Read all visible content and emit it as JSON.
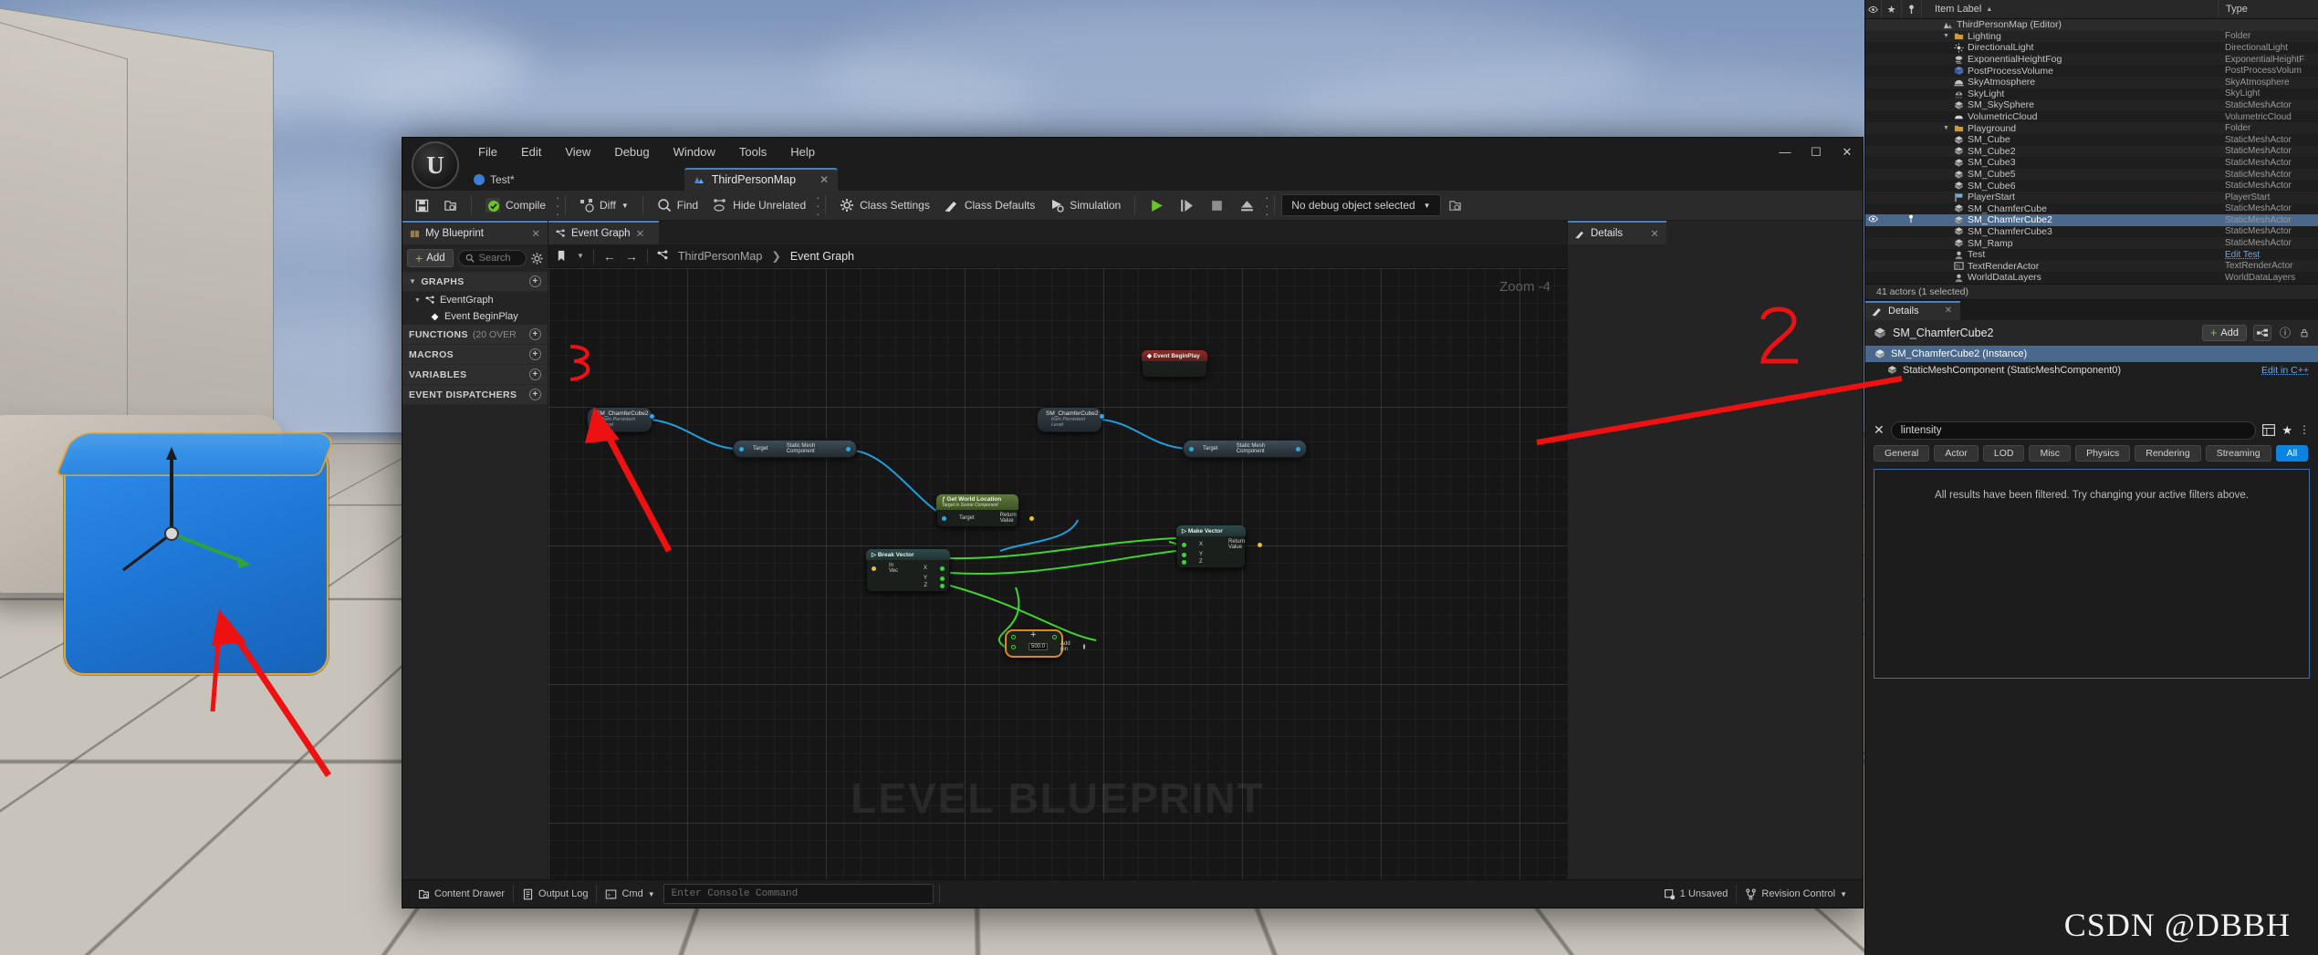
{
  "blueprint_window": {
    "menu": [
      "File",
      "Edit",
      "View",
      "Debug",
      "Window",
      "Tools",
      "Help"
    ],
    "window_controls": {
      "minimize": "—",
      "maximize": "☐",
      "close": "✕"
    },
    "asset_chip": "Test*",
    "document_tab": {
      "label": "ThirdPersonMap",
      "close": "✕"
    },
    "toolbar": {
      "save_icon": "save-icon",
      "browse_icon": "browse-icon",
      "compile": "Compile",
      "diff": "Diff",
      "find": "Find",
      "hide_unrelated": "Hide Unrelated",
      "class_settings": "Class Settings",
      "class_defaults": "Class Defaults",
      "simulation": "Simulation",
      "play": "play-icon",
      "step": "step-icon",
      "stop": "stop-icon",
      "eject": "eject-icon",
      "debug_combo": "No debug object selected"
    },
    "my_blueprint": {
      "tab_label": "My Blueprint",
      "add_label": "Add",
      "search_placeholder": "Search",
      "sections": [
        {
          "label": "GRAPHS",
          "suffix": ""
        },
        {
          "label": "FUNCTIONS",
          "suffix": "(20 OVER"
        },
        {
          "label": "MACROS",
          "suffix": ""
        },
        {
          "label": "VARIABLES",
          "suffix": ""
        },
        {
          "label": "EVENT DISPATCHERS",
          "suffix": ""
        }
      ],
      "graph_items": [
        "EventGraph",
        "Event BeginPlay"
      ]
    },
    "graph": {
      "tab_label": "Event Graph",
      "breadcrumb_root": "ThirdPersonMap",
      "breadcrumb_sep": "❯",
      "breadcrumb_current": "Event Graph",
      "zoom_label": "Zoom  -4",
      "watermark": "LEVEL BLUEPRINT",
      "nodes": {
        "ref1_title": "SM_ChamferCube2",
        "ref1_sub": "from Persistent Level",
        "comp1_in": "Target",
        "comp1_out": "Static Mesh Component",
        "ref2_title": "SM_ChamferCube2",
        "ref2_sub": "from Persistent Level",
        "comp2_in": "Target",
        "comp2_out": "Static Mesh Component",
        "getworld_title": "Get World Location",
        "getworld_sub": "Target is Scene Component",
        "getworld_in": "Target",
        "getworld_out": "Return Value",
        "breakvec_title": "Break Vector",
        "breakvec_in": "In Vec",
        "breakvec_x": "X",
        "breakvec_y": "Y",
        "breakvec_z": "Z",
        "makevec_title": "Make Vector",
        "makevec_x": "X",
        "makevec_y": "Y",
        "makevec_z": "Z",
        "makevec_out": "Return Value",
        "add_value": "500.0",
        "add_pin": "Add pin",
        "event_beginplay": "Event BeginPlay"
      }
    },
    "details_tab": {
      "label": "Details",
      "close": "✕"
    },
    "status_bar": {
      "content_drawer": "Content Drawer",
      "output_log": "Output Log",
      "cmd": "Cmd",
      "console_placeholder": "Enter Console Command",
      "unsaved": "1 Unsaved",
      "revision_control": "Revision Control"
    }
  },
  "outliner": {
    "columns": {
      "eye": "eye-icon",
      "star": "★",
      "pin": "pin-icon",
      "label": "Item Label",
      "sort": "▲",
      "type": "Type"
    },
    "rows": [
      {
        "label": "ThirdPersonMap (Editor)",
        "type": "",
        "icon": "map-icon",
        "indent": 2,
        "selected": false,
        "header": true
      },
      {
        "label": "Lighting",
        "type": "Folder",
        "icon": "folder-icon",
        "indent": 2,
        "caret": "▼",
        "selected": false
      },
      {
        "label": "DirectionalLight",
        "type": "DirectionalLight",
        "icon": "light-icon",
        "indent": 3,
        "selected": false
      },
      {
        "label": "ExponentialHeightFog",
        "type": "ExponentialHeightF",
        "icon": "fog-icon",
        "indent": 3,
        "selected": false
      },
      {
        "label": "PostProcessVolume",
        "type": "PostProcessVolum",
        "icon": "volume-icon",
        "indent": 3,
        "selected": false
      },
      {
        "label": "SkyAtmosphere",
        "type": "SkyAtmosphere",
        "icon": "atmosphere-icon",
        "indent": 3,
        "selected": false
      },
      {
        "label": "SkyLight",
        "type": "SkyLight",
        "icon": "skylight-icon",
        "indent": 3,
        "selected": false
      },
      {
        "label": "SM_SkySphere",
        "type": "StaticMeshActor",
        "icon": "mesh-icon",
        "indent": 3,
        "selected": false
      },
      {
        "label": "VolumetricCloud",
        "type": "VolumetricCloud",
        "icon": "cloud-icon",
        "indent": 3,
        "selected": false
      },
      {
        "label": "Playground",
        "type": "Folder",
        "icon": "folder-icon",
        "indent": 2,
        "caret": "▼",
        "selected": false
      },
      {
        "label": "SM_Cube",
        "type": "StaticMeshActor",
        "icon": "mesh-icon",
        "indent": 3,
        "selected": false
      },
      {
        "label": "SM_Cube2",
        "type": "StaticMeshActor",
        "icon": "mesh-icon",
        "indent": 3,
        "selected": false
      },
      {
        "label": "SM_Cube3",
        "type": "StaticMeshActor",
        "icon": "mesh-icon",
        "indent": 3,
        "selected": false
      },
      {
        "label": "SM_Cube5",
        "type": "StaticMeshActor",
        "icon": "mesh-icon",
        "indent": 3,
        "selected": false
      },
      {
        "label": "SM_Cube6",
        "type": "StaticMeshActor",
        "icon": "mesh-icon",
        "indent": 3,
        "selected": false
      },
      {
        "label": "PlayerStart",
        "type": "PlayerStart",
        "icon": "playerstart-icon",
        "indent": 3,
        "selected": false
      },
      {
        "label": "SM_ChamferCube",
        "type": "StaticMeshActor",
        "icon": "mesh-icon",
        "indent": 3,
        "selected": false
      },
      {
        "label": "SM_ChamferCube2",
        "type": "StaticMeshActor",
        "icon": "mesh-icon",
        "indent": 3,
        "selected": true
      },
      {
        "label": "SM_ChamferCube3",
        "type": "StaticMeshActor",
        "icon": "mesh-icon",
        "indent": 3,
        "selected": false
      },
      {
        "label": "SM_Ramp",
        "type": "StaticMeshActor",
        "icon": "mesh-icon",
        "indent": 3,
        "selected": false
      },
      {
        "label": "Test",
        "type": "Edit Test",
        "type_link": true,
        "icon": "actor-icon",
        "indent": 3,
        "selected": false
      },
      {
        "label": "TextRenderActor",
        "type": "TextRenderActor",
        "icon": "text-icon",
        "indent": 3,
        "selected": false
      },
      {
        "label": "WorldDataLayers",
        "type": "WorldDataLayers",
        "icon": "actor-icon",
        "indent": 3,
        "selected": false
      }
    ],
    "status": "41 actors (1 selected)"
  },
  "details_panel": {
    "tab_label": "Details",
    "tab_close": "✕",
    "title": "SM_ChamferCube2",
    "add_label": "Add",
    "grid_icon": "components-icon",
    "help_icon": "ⓘ",
    "lock_icon": "lock-icon",
    "components": [
      {
        "label": "SM_ChamferCube2 (Instance)",
        "selected": true,
        "edit": ""
      },
      {
        "label": "StaticMeshComponent (StaticMeshComponent0)",
        "selected": false,
        "edit": "Edit in C++"
      }
    ],
    "filter_value": "lintensity",
    "filter_clear": "✕",
    "settings_icons": [
      "table-icon",
      "star-icon",
      "settings-icon"
    ],
    "chips": [
      {
        "label": "General",
        "active": false
      },
      {
        "label": "Actor",
        "active": false
      },
      {
        "label": "LOD",
        "active": false
      },
      {
        "label": "Misc",
        "active": false
      },
      {
        "label": "Physics",
        "active": false
      },
      {
        "label": "Rendering",
        "active": false
      },
      {
        "label": "Streaming",
        "active": false
      },
      {
        "label": "All",
        "active": true
      }
    ],
    "empty_message": "All results have been filtered. Try changing your active filters above."
  },
  "watermark": "CSDN @DBBH"
}
